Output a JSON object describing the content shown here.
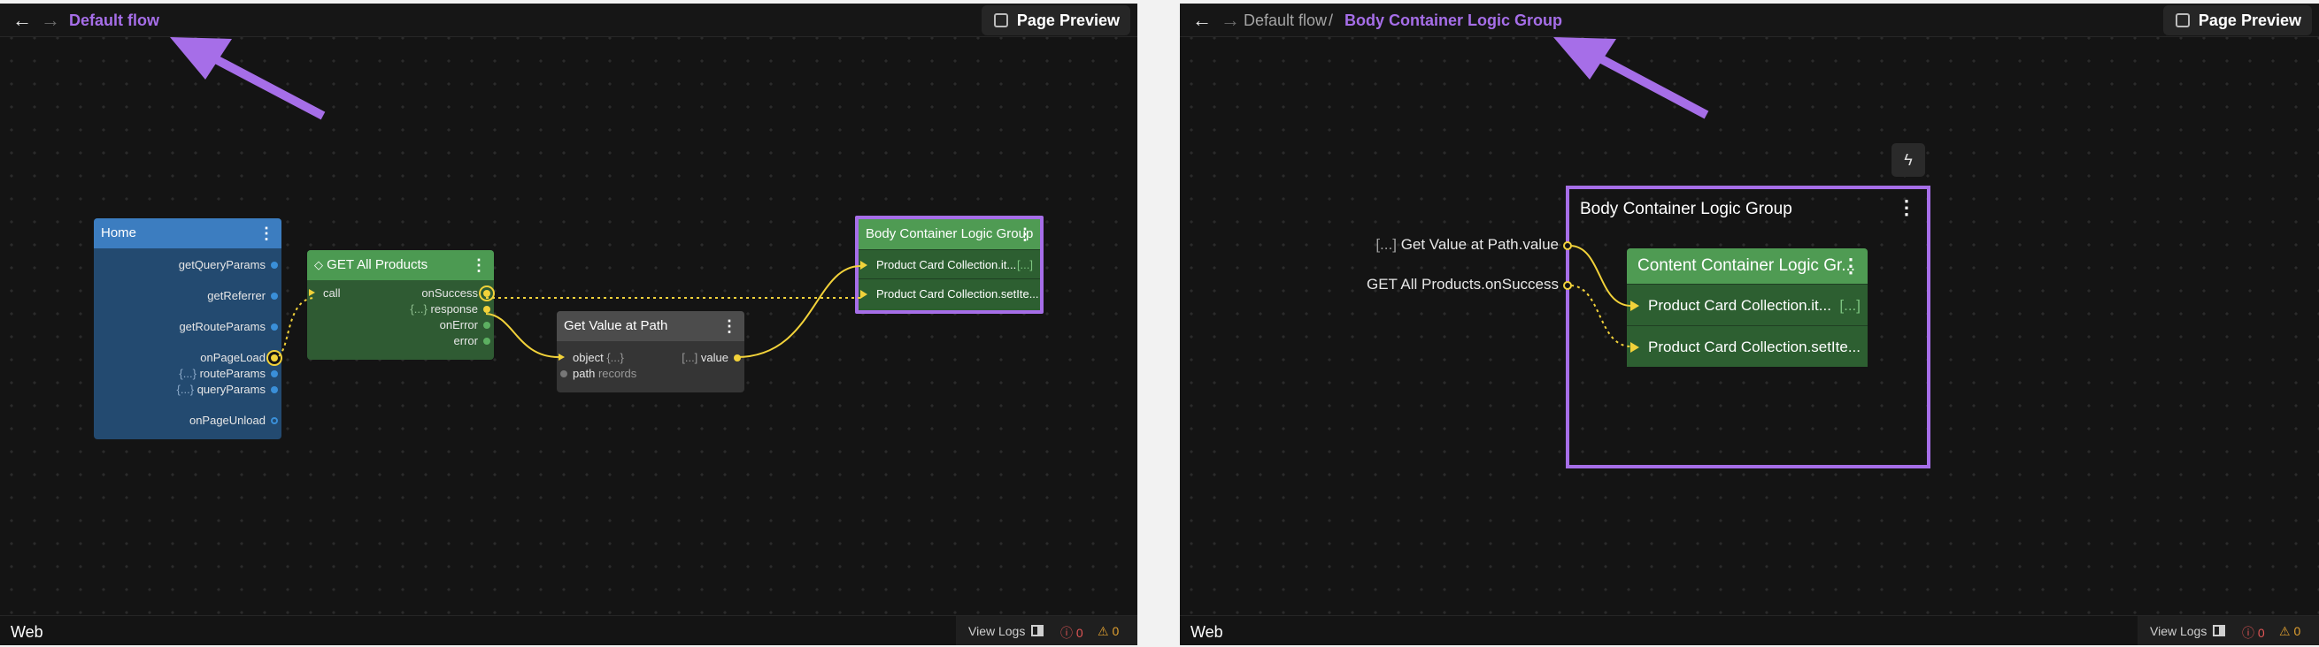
{
  "panel1": {
    "breadcrumb": [
      "Default flow"
    ],
    "page_preview_label": "Page Preview",
    "env_label": "Web",
    "view_logs_label": "View Logs",
    "error_count": "0",
    "warning_count": "0",
    "nodes": {
      "home": {
        "title": "Home",
        "ports": [
          "getQueryParams",
          "getReferrer",
          "getRouteParams",
          "onPageLoad",
          "routeParams",
          "queryParams",
          "onPageUnload"
        ],
        "gap_marker": "{...}"
      },
      "get_all_products": {
        "title": "GET All Products",
        "input": "call",
        "outputs": [
          "onSuccess",
          "response",
          "onError",
          "error"
        ],
        "gap_marker": "{...}"
      },
      "get_value_at_path": {
        "title": "Get Value at Path",
        "inputs": [
          "object",
          "path"
        ],
        "object_placeholder": "{...}",
        "path_value": "records",
        "output": "value",
        "output_marker": "[...]"
      },
      "body_container": {
        "title": "Body Container Logic Group",
        "rows": [
          "Product Card Collection.it...",
          "Product Card Collection.setIte..."
        ],
        "row_marker": "[...]"
      }
    }
  },
  "panel2": {
    "breadcrumb": [
      "Default flow",
      "Body Container Logic Group"
    ],
    "separator": "/",
    "page_preview_label": "Page Preview",
    "env_label": "Web",
    "view_logs_label": "View Logs",
    "error_count": "0",
    "warning_count": "0",
    "group": {
      "title": "Body Container Logic Group",
      "external_inputs": [
        {
          "marker": "[...]",
          "label": "Get Value at Path.value"
        },
        {
          "marker": "",
          "label": "GET All Products.onSuccess"
        }
      ],
      "inner_node": {
        "title": "Content Container Logic Gr...",
        "rows": [
          "Product Card Collection.it...",
          "Product Card Collection.setIte..."
        ],
        "row_marker": "[...]"
      }
    }
  },
  "icons": [
    "back-arrow-icon",
    "forward-arrow-icon",
    "preview-icon",
    "kebab-icon",
    "flash-icon",
    "panel-icon",
    "error-icon",
    "warning-icon"
  ],
  "colors": {
    "accent_purple": "#a66ee8",
    "connection_yellow": "#f2d23a",
    "node_blue": "#3c7dc0",
    "node_green": "#4c9a52",
    "node_gray": "#4c4c4c"
  }
}
